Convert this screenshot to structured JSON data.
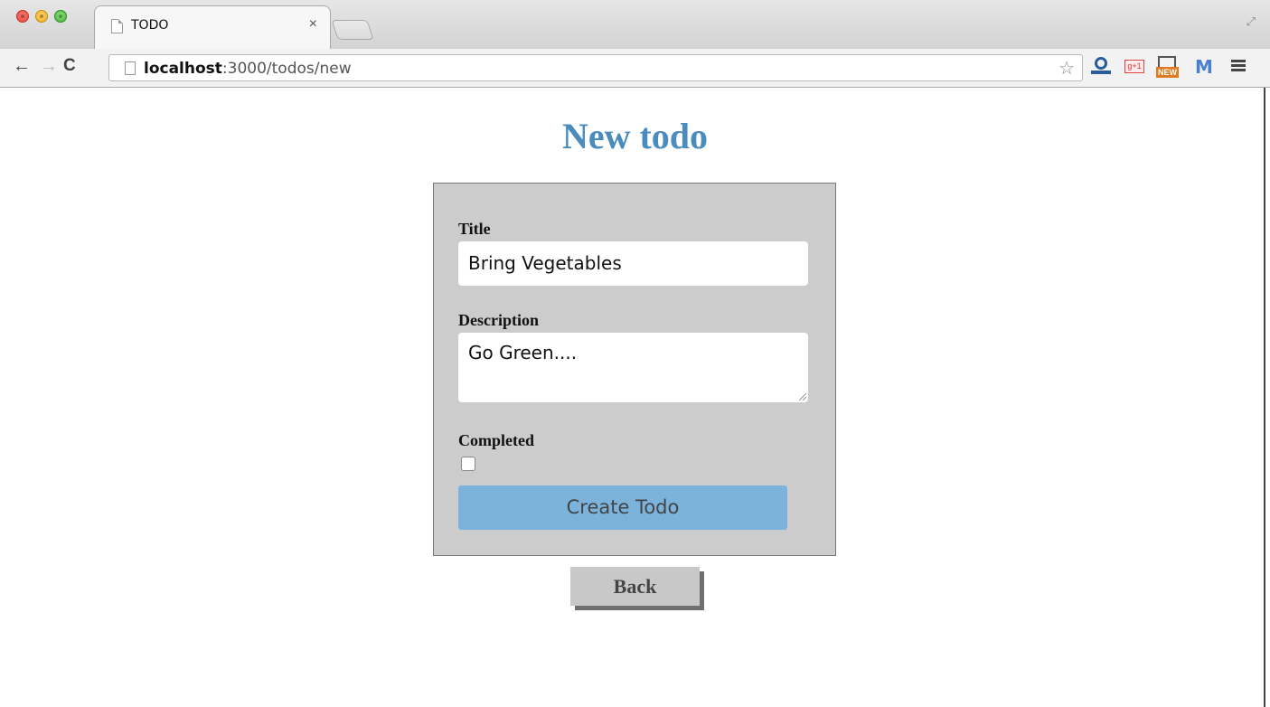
{
  "browser": {
    "tab": {
      "title": "TODO",
      "close_glyph": "×"
    },
    "address": {
      "host": "localhost",
      "path": ":3000/todos/new"
    },
    "icons": {
      "back": "back-arrow-icon",
      "forward": "forward-arrow-icon",
      "reload": "reload-icon",
      "bookmark": "star-icon",
      "menu": "hamburger-menu-icon"
    },
    "extensions": {
      "gplus_label": "g+1",
      "new_badge": "NEW",
      "gmail_label": "M"
    }
  },
  "page": {
    "heading": "New todo",
    "form": {
      "title_label": "Title",
      "title_value": "Bring Vegetables",
      "description_label": "Description",
      "description_value": "Go Green....",
      "completed_label": "Completed",
      "completed_checked": false,
      "submit_label": "Create Todo"
    },
    "back_label": "Back"
  },
  "colors": {
    "heading": "#4a8cbd",
    "form_background": "#cccccc",
    "submit_button": "#7bb3dd",
    "back_button": "#c8c8c8"
  }
}
